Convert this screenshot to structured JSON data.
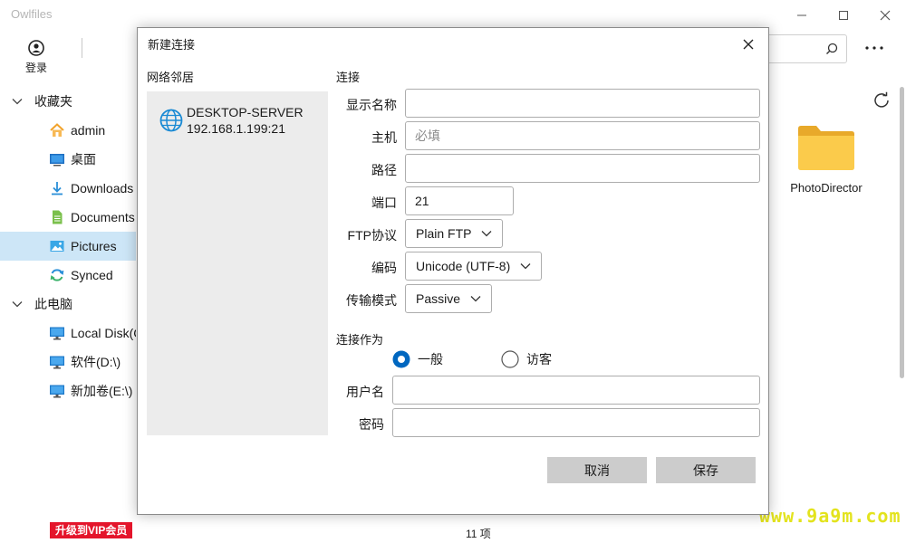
{
  "app": {
    "title": "Owlfiles",
    "login_label": "登录",
    "items_count": "11 项",
    "vip_label": "升级到VIP会员",
    "watermark": "www.9a9m.com"
  },
  "sidebar": {
    "favorites_label": "收藏夹",
    "favorites": [
      {
        "label": "admin",
        "icon": "home-icon"
      },
      {
        "label": "桌面",
        "icon": "desktop-icon"
      },
      {
        "label": "Downloads",
        "icon": "download-icon"
      },
      {
        "label": "Documents",
        "icon": "document-icon"
      },
      {
        "label": "Pictures",
        "icon": "pictures-icon"
      },
      {
        "label": "Synced",
        "icon": "sync-icon"
      }
    ],
    "computer_label": "此电脑",
    "drives": [
      {
        "label": "Local Disk(C:\\)",
        "icon": "monitor-icon"
      },
      {
        "label": "软件(D:\\)",
        "icon": "monitor-icon"
      },
      {
        "label": "新加卷(E:\\)",
        "icon": "monitor-icon"
      }
    ]
  },
  "content": {
    "folder_name": "PhotoDirector"
  },
  "dialog": {
    "title": "新建连接",
    "neighborhood_title": "网络邻居",
    "neighbor": {
      "name": "DESKTOP-SERVER",
      "address": "192.168.1.199:21"
    },
    "connection_section": "连接",
    "fields": {
      "display_name_label": "显示名称",
      "display_name_value": "",
      "host_label": "主机",
      "host_placeholder": "必填",
      "path_label": "路径",
      "path_value": "",
      "port_label": "端口",
      "port_value": "21",
      "protocol_label": "FTP协议",
      "protocol_value": "Plain FTP",
      "encoding_label": "编码",
      "encoding_value": "Unicode (UTF-8)",
      "transfer_label": "传输模式",
      "transfer_value": "Passive"
    },
    "connect_as_section": "连接作为",
    "radio_general": "一般",
    "radio_guest": "访客",
    "username_label": "用户名",
    "username_value": "",
    "password_label": "密码",
    "password_value": "",
    "cancel_label": "取消",
    "save_label": "保存"
  },
  "colors": {
    "accent": "#0067c0",
    "selected_bg": "#cde6f7",
    "button_bg": "#cccccc",
    "panel_bg": "#ececec"
  }
}
